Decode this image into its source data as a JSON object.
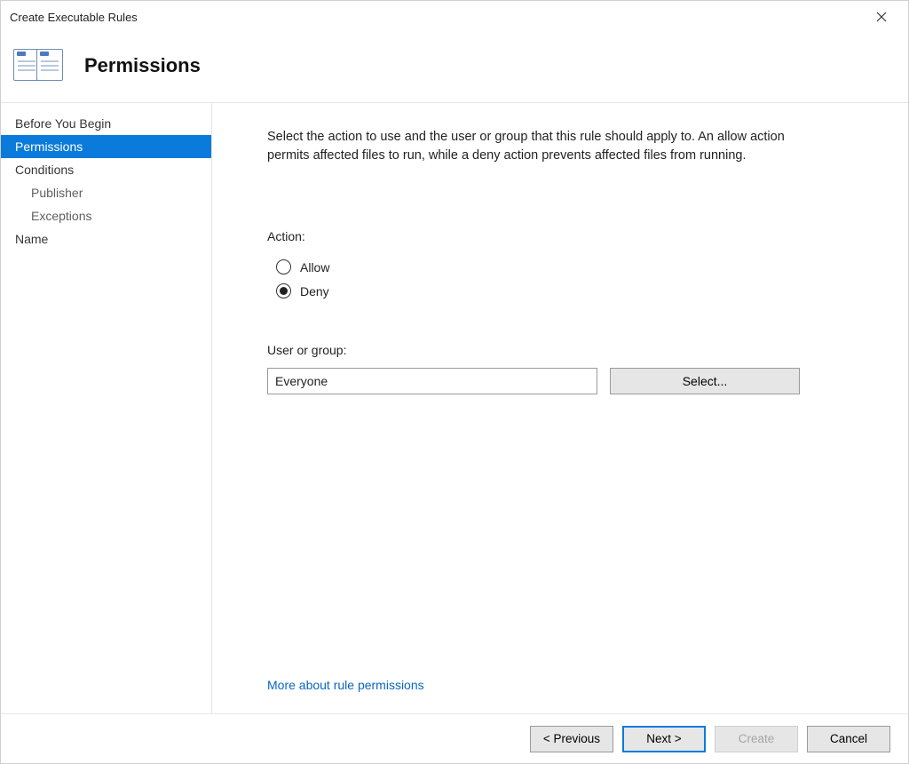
{
  "window": {
    "title": "Create Executable Rules"
  },
  "header": {
    "title": "Permissions"
  },
  "sidebar": {
    "items": [
      {
        "label": "Before You Begin",
        "sub": false,
        "selected": false
      },
      {
        "label": "Permissions",
        "sub": false,
        "selected": true
      },
      {
        "label": "Conditions",
        "sub": false,
        "selected": false
      },
      {
        "label": "Publisher",
        "sub": true,
        "selected": false
      },
      {
        "label": "Exceptions",
        "sub": true,
        "selected": false
      },
      {
        "label": "Name",
        "sub": false,
        "selected": false
      }
    ]
  },
  "main": {
    "instructions": "Select the action to use and the user or group that this rule should apply to. An allow action permits affected files to run, while a deny action prevents affected files from running.",
    "action_label": "Action:",
    "actions": {
      "allow": "Allow",
      "deny": "Deny",
      "selected": "deny"
    },
    "user_group_label": "User or group:",
    "user_group_value": "Everyone",
    "select_button": "Select...",
    "more_link": "More about rule permissions"
  },
  "footer": {
    "previous": "< Previous",
    "next": "Next >",
    "create": "Create",
    "cancel": "Cancel"
  }
}
